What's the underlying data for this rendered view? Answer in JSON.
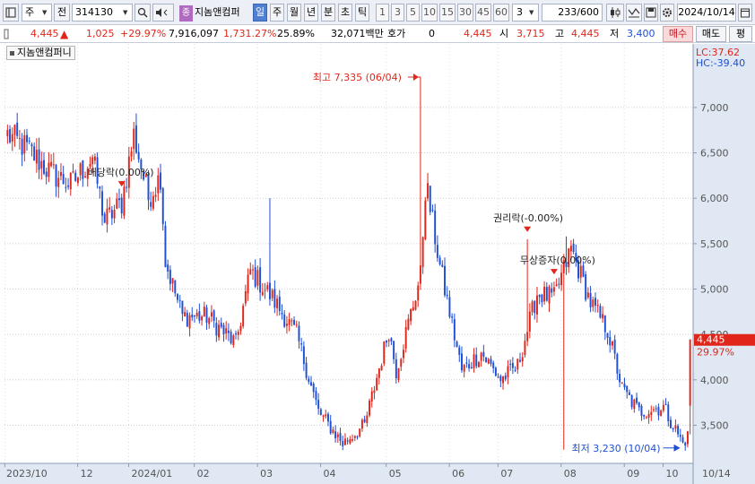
{
  "toolbar": {
    "market_select": "주",
    "market_prev": "전",
    "code_value": "314130",
    "stock_tag": "종",
    "stock_name": "지놈앤컴퍼",
    "periods": [
      "일",
      "주",
      "월",
      "년",
      "분",
      "초",
      "틱"
    ],
    "active_period": "일",
    "intervals": [
      "1",
      "3",
      "5",
      "10",
      "15",
      "30",
      "45",
      "60"
    ],
    "interval_select": "3",
    "count_label": "233",
    "count_total": "/600",
    "date_value": "2024/10/14"
  },
  "info": {
    "price": "4,445",
    "change": "1,025",
    "change_pct": "+29.97%",
    "volume": "7,916,097",
    "volume_pct": "1,731.27%",
    "turnover": "25.89%",
    "amount": "32,071백만",
    "quote_label": "호가",
    "quote_value": "0",
    "quote_price": "4,445",
    "open_label": "시",
    "open_value": "3,715",
    "high_label": "고",
    "high_value": "4,445",
    "low_label": "저",
    "low_value": "3,400",
    "buy_label": "매수",
    "sell_label": "매도",
    "eval_label": "평"
  },
  "colors": {
    "up": "#e0261b",
    "down": "#1f4fd6",
    "axis_bg": "#dfe8f3"
  },
  "chart_data": {
    "type": "candlestick",
    "title": "지놈앤컴퍼니",
    "lc_label": "LC:37.62",
    "hc_label": "HC:-39.40",
    "ylim": [
      3080,
      7700
    ],
    "y_ticks": [
      3500,
      4000,
      4500,
      5000,
      5500,
      6000,
      6500,
      7000
    ],
    "y_tick_labels": [
      "3,500",
      "4,000",
      "4,500",
      "5,000",
      "5,500",
      "6,000",
      "6,500",
      "7,000"
    ],
    "x_tick_labels": [
      "2023/10",
      "12",
      "2024/01",
      "02",
      "03",
      "04",
      "05",
      "06",
      "07",
      "08",
      "09",
      "10",
      "10/14"
    ],
    "current_price_label": "4,445",
    "current_pct_label": "29.97%",
    "current_price": 4445,
    "max_annotation": "최고 7,335 (06/04)",
    "min_annotation": "최저 3,230 (10/04)",
    "events": [
      "배당락(0.00%)",
      "권리락(-0.00%)",
      "무상증자(0.00%)"
    ],
    "anchors": [
      [
        0,
        6700,
        6700
      ],
      [
        8,
        6400,
        6550
      ],
      [
        17,
        6150,
        6300
      ],
      [
        26,
        6100,
        6150
      ],
      [
        35,
        6350,
        6450
      ],
      [
        40,
        5800,
        5750
      ],
      [
        47,
        5900,
        5950
      ],
      [
        52,
        6500,
        6700
      ],
      [
        58,
        6000,
        6000
      ],
      [
        63,
        6300,
        6250
      ],
      [
        65,
        5400,
        5300
      ],
      [
        72,
        4750,
        4700
      ],
      [
        82,
        4650,
        4700
      ],
      [
        94,
        4450,
        4400
      ],
      [
        100,
        5000,
        5200
      ],
      [
        109,
        4950,
        4900
      ],
      [
        119,
        4450,
        4500
      ],
      [
        128,
        3650,
        3650
      ],
      [
        138,
        3320,
        3300
      ],
      [
        147,
        3450,
        3500
      ],
      [
        157,
        4400,
        4550
      ],
      [
        160,
        4050,
        4100
      ],
      [
        170,
        5050,
        5150
      ],
      [
        172,
        6050,
        6100
      ],
      [
        173,
        5950,
        6050
      ],
      [
        178,
        5350,
        5250
      ],
      [
        187,
        4100,
        4100
      ],
      [
        195,
        4250,
        4300
      ],
      [
        203,
        4050,
        4000
      ],
      [
        210,
        4200,
        4150
      ],
      [
        218,
        4850,
        4950
      ],
      [
        225,
        4850,
        4900
      ],
      [
        232,
        5300,
        5450
      ],
      [
        240,
        4800,
        4850
      ],
      [
        247,
        4600,
        4550
      ],
      [
        253,
        3950,
        3900
      ],
      [
        260,
        3650,
        3650
      ],
      [
        270,
        3700,
        3700
      ],
      [
        278,
        3350,
        3300
      ],
      [
        281,
        3400,
        3420
      ]
    ],
    "last_candle": {
      "open": 3715,
      "high": 4445,
      "low": 3400,
      "close": 4445
    },
    "spikes": [
      {
        "i": 170,
        "high": 7335
      },
      {
        "i": 108,
        "high": 6000
      },
      {
        "i": 214,
        "high": 5550
      },
      {
        "i": 230,
        "high": 5580
      },
      {
        "i": 229,
        "low": 3230
      }
    ]
  }
}
